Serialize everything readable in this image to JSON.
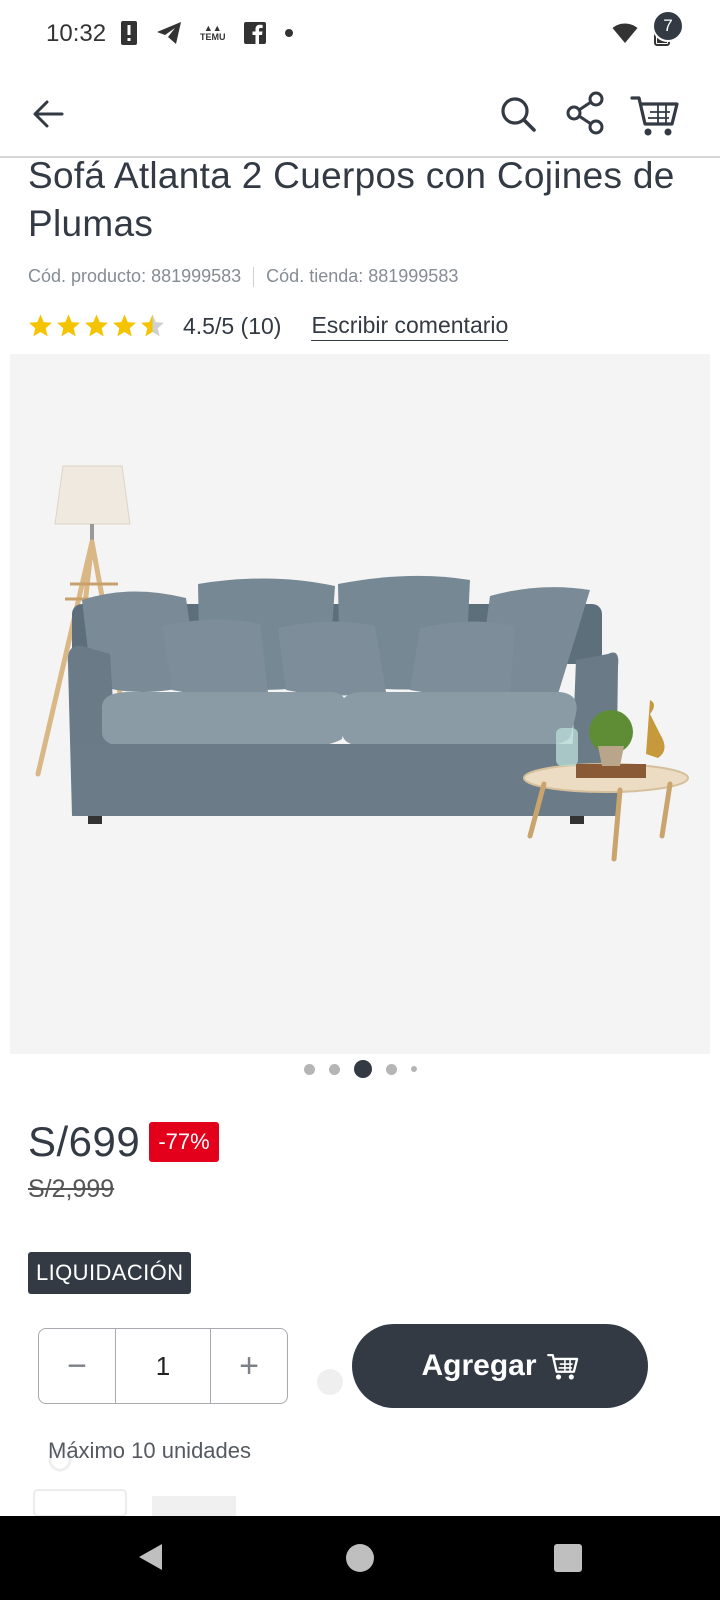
{
  "status_bar": {
    "time": "10:32",
    "left_icons": [
      "alert-icon",
      "telegram-icon",
      "temu-icon",
      "facebook-icon",
      "dot-icon"
    ],
    "temu_label": "TEMU",
    "right_icons": [
      "wifi-icon",
      "battery-icon"
    ]
  },
  "header": {
    "icons": [
      "back-arrow-icon",
      "search-icon",
      "share-icon",
      "cart-icon"
    ],
    "cart_count": "7"
  },
  "product": {
    "title": "Sofá Atlanta 2 Cuerpos con Cojines de Plumas",
    "product_code": "Cód. producto: 881999583",
    "store_code": "Cód. tienda: 881999583",
    "rating": 4.5,
    "rating_text": "4.5/5 (10)",
    "write_review": "Escribir comentario",
    "image": {
      "total": 5,
      "active": 2
    },
    "price": "S/699",
    "discount": "-77%",
    "old_price": "S/2,999",
    "tag": "LIQUIDACIÓN"
  },
  "purchase": {
    "minus": "−",
    "quantity": "1",
    "plus": "+",
    "add_label": "Agregar",
    "max_units": "Máximo 10 unidades"
  },
  "colors": {
    "dark": "#333a44",
    "discount_red": "#e3001b",
    "star": "#f5c400"
  }
}
